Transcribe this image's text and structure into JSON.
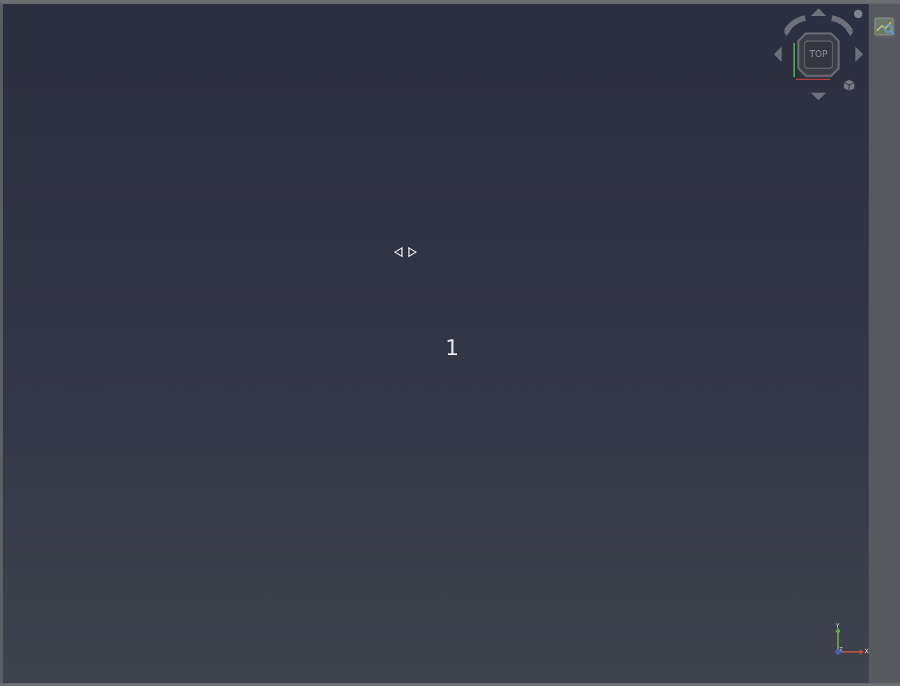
{
  "viewport": {
    "background_top": "#2c2f3f",
    "background_bottom": "#3e424d",
    "center_number": "1"
  },
  "nav_cube": {
    "face_label": "TOP",
    "icons": [
      "rotate-left-icon",
      "rotate-right-icon",
      "arrow-up-icon",
      "arrow-down-icon",
      "arrow-left-icon",
      "arrow-right-icon",
      "home-cube-icon",
      "menu-dot-icon"
    ],
    "x_axis_color": "#b43a3a",
    "y_axis_color": "#4fae4f"
  },
  "axis_triad": {
    "x_label": "X",
    "y_label": "Y",
    "z_label": "Z",
    "x_color": "#c0563a",
    "y_color": "#6aa84f",
    "z_color": "#4a5bb8"
  },
  "right_panel": {
    "tool_icon": "map-tool-icon"
  },
  "overlay_nav": {
    "icons": [
      "prev-arrow-icon",
      "next-arrow-icon"
    ]
  }
}
